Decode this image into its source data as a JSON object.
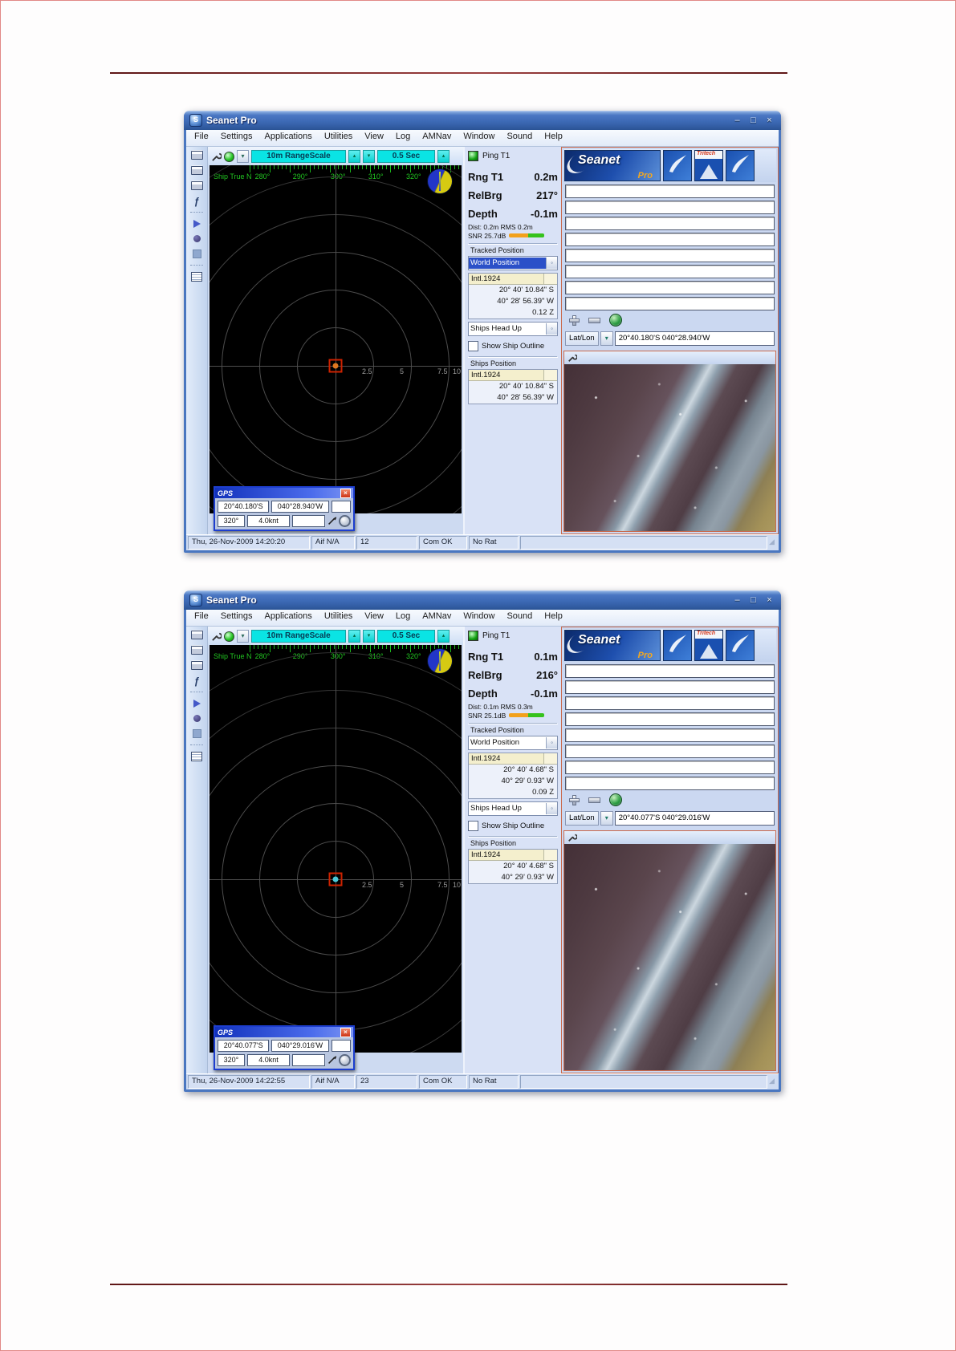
{
  "menu": {
    "items": [
      "File",
      "Settings",
      "Applications",
      "Utilities",
      "View",
      "Log",
      "AMNav",
      "Window",
      "Sound",
      "Help"
    ]
  },
  "sonar": {
    "heading_label": "Ship True N",
    "compass_labels": [
      "280°",
      "290°",
      "300°",
      "310°",
      "320°"
    ],
    "ring_labels": [
      "2.5",
      "5",
      "7.5",
      "10"
    ]
  },
  "shared": {
    "logo_main": "Seanet",
    "logo_sub": "Pro",
    "logo_tritech": "Tritech",
    "latlon_label": "Lat/Lon",
    "app_initial": "S",
    "minimize_glyph": "–",
    "maximize_glyph": "□",
    "close_glyph": "×",
    "spin_up_glyph": "▴",
    "spin_down_glyph": "▾",
    "grip_glyph": "◢",
    "colors": {
      "cyan_accent": "#0ae4e4",
      "snr_orange": "#f2a11c",
      "snr_green": "#35c21c",
      "compass_green": "#21c521",
      "panel_border_salmon": "#c96a4e"
    }
  },
  "windows": [
    {
      "title": "Seanet Pro",
      "range_scale": "10m RangeScale",
      "rep_rate": "0.5 Sec",
      "ping_label": "Ping T1",
      "readouts": [
        {
          "label": "Rng T1",
          "value": "0.2m"
        },
        {
          "label": "RelBrg",
          "value": "217°"
        },
        {
          "label": "Depth",
          "value": "-0.1m"
        }
      ],
      "dist_line": "Dist: 0.2m RMS 0.2m",
      "snr_line": "SNR 25.7dB",
      "tracked_position_label": "Tracked Position",
      "world_position": "World Position",
      "world_position_highlighted": true,
      "datum": "Intl.1924",
      "world_lat": "20° 40' 10.84\" S",
      "world_lon": "40° 28' 56.39\" W",
      "world_z": "0.12 Z",
      "orientation": "Ships Head Up",
      "show_ship_outline": "Show Ship Outline",
      "ships_position_label": "Ships Position",
      "ships_datum": "Intl.1924",
      "ships_lat": "20° 40' 10.84\" S",
      "ships_lon": "40° 28' 56.39\" W",
      "latlon_value": "20°40.180'S 040°28.940'W",
      "marker_color": "#e07820",
      "gps": {
        "title": "GPS",
        "close_glyph": "×",
        "lat": "20°40.180'S",
        "lon": "040°28.940'W",
        "cog": "320°",
        "speed": "4.0knt"
      },
      "status": {
        "datetime": "Thu, 26-Nov-2009 14:20:20",
        "alt": "Aif N/A",
        "count": "12",
        "com": "Com OK",
        "rat": "No Rat"
      }
    },
    {
      "title": "Seanet Pro",
      "range_scale": "10m RangeScale",
      "rep_rate": "0.5 Sec",
      "ping_label": "Ping T1",
      "readouts": [
        {
          "label": "Rng T1",
          "value": "0.1m"
        },
        {
          "label": "RelBrg",
          "value": "216°"
        },
        {
          "label": "Depth",
          "value": "-0.1m"
        }
      ],
      "dist_line": "Dist: 0.1m RMS 0.3m",
      "snr_line": "SNR 25.1dB",
      "tracked_position_label": "Tracked Position",
      "world_position": "World Position",
      "world_position_highlighted": false,
      "datum": "Intl.1924",
      "world_lat": "20° 40' 4.68\" S",
      "world_lon": "40° 29' 0.93\" W",
      "world_z": "0.09 Z",
      "orientation": "Ships Head Up",
      "show_ship_outline": "Show Ship Outline",
      "ships_position_label": "Ships Position",
      "ships_datum": "Intl.1924",
      "ships_lat": "20° 40' 4.68\" S",
      "ships_lon": "40° 29' 0.93\" W",
      "latlon_value": "20°40.077'S 040°29.016'W",
      "marker_color": "#49c8d8",
      "gps": {
        "title": "GPS",
        "close_glyph": "×",
        "lat": "20°40.077'S",
        "lon": "040°29.016'W",
        "cog": "320°",
        "speed": "4.0knt"
      },
      "status": {
        "datetime": "Thu, 26-Nov-2009 14:22:55",
        "alt": "Aif N/A",
        "count": "23",
        "com": "Com OK",
        "rat": "No Rat"
      }
    }
  ]
}
